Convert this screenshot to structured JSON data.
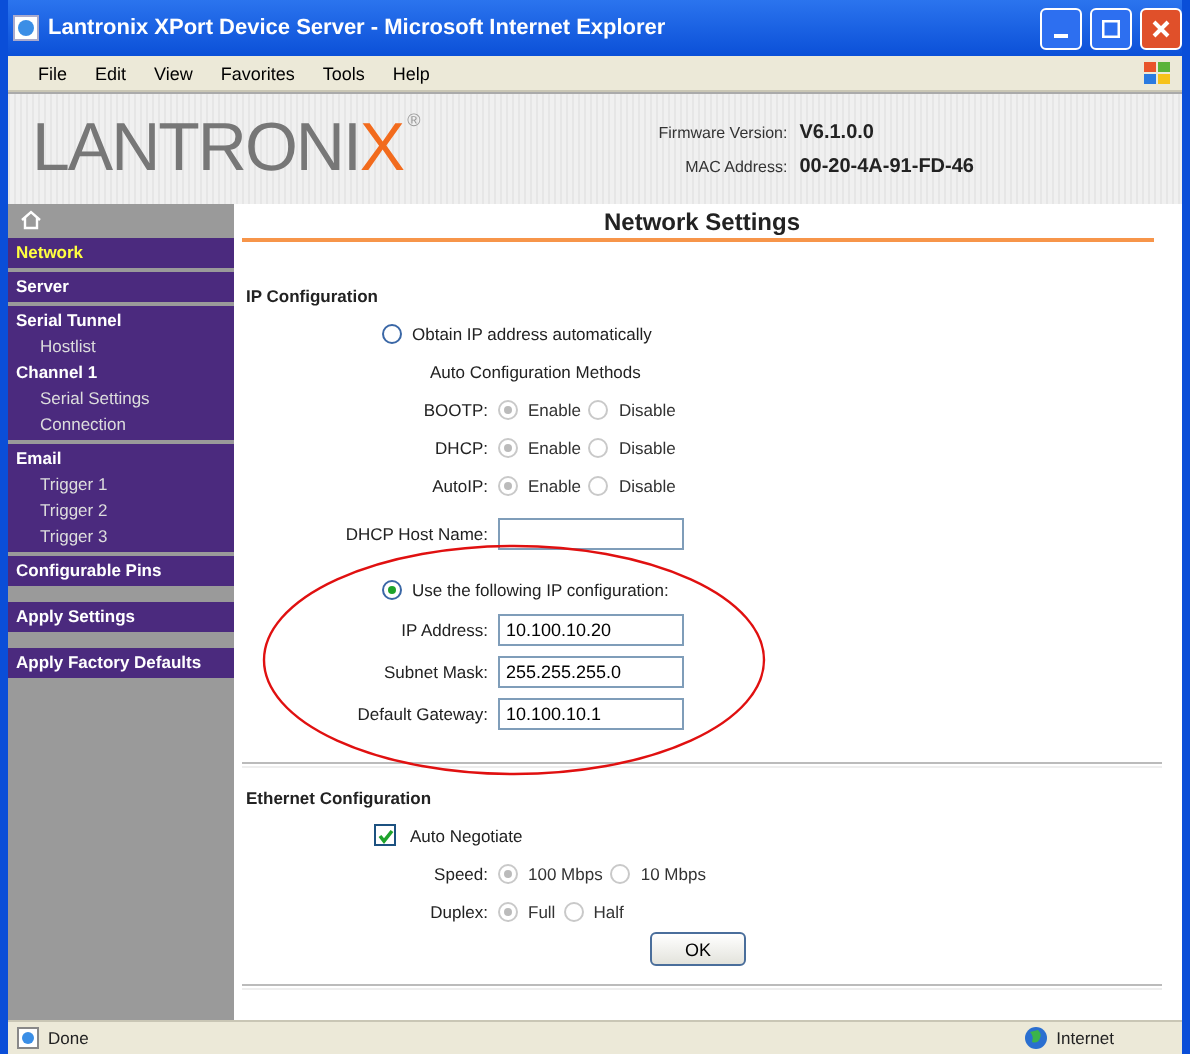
{
  "window": {
    "title": "Lantronix XPort Device Server - Microsoft Internet Explorer"
  },
  "menu": [
    "File",
    "Edit",
    "View",
    "Favorites",
    "Tools",
    "Help"
  ],
  "header": {
    "logo": {
      "text": "LANTRONI",
      "accent": "X",
      "mark": "®"
    },
    "firmware_label": "Firmware Version:",
    "firmware": "V6.1.0.0",
    "mac_label": "MAC Address:",
    "mac": "00-20-4A-91-FD-46"
  },
  "sidebar": {
    "groups": [
      [
        {
          "label": "Network",
          "selected": true
        }
      ],
      [
        {
          "label": "Server",
          "selected": false
        }
      ],
      [
        {
          "label": "Serial Tunnel",
          "selected": false,
          "children": [
            {
              "label": "Hostlist",
              "selected": false
            }
          ]
        },
        {
          "label": "Channel 1",
          "selected": false,
          "children": [
            {
              "label": "Serial Settings",
              "selected": false
            },
            {
              "label": "Connection",
              "selected": false
            }
          ]
        }
      ],
      [
        {
          "label": "Email",
          "selected": false,
          "children": [
            {
              "label": "Trigger 1",
              "selected": false
            },
            {
              "label": "Trigger 2",
              "selected": false
            },
            {
              "label": "Trigger 3",
              "selected": false
            }
          ]
        }
      ],
      [
        {
          "label": "Configurable Pins",
          "selected": false
        }
      ],
      [
        {
          "label": "Apply Settings",
          "selected": false
        }
      ],
      [
        {
          "label": "Apply Factory Defaults",
          "selected": false
        }
      ]
    ]
  },
  "page_title": "Network Settings",
  "ip_config": {
    "heading": "IP Configuration",
    "auto_option": {
      "label": "Obtain IP address automatically",
      "selected": false
    },
    "methods_heading": "Auto Configuration Methods",
    "methods": [
      {
        "label": "BOOTP:",
        "disabled": true,
        "options": [
          {
            "label": "Enable",
            "selected": true
          },
          {
            "label": "Disable",
            "selected": false
          }
        ]
      },
      {
        "label": "DHCP:",
        "disabled": true,
        "options": [
          {
            "label": "Enable",
            "selected": true
          },
          {
            "label": "Disable",
            "selected": false
          }
        ]
      },
      {
        "label": "AutoIP:",
        "disabled": true,
        "options": [
          {
            "label": "Enable",
            "selected": true
          },
          {
            "label": "Disable",
            "selected": false
          }
        ]
      }
    ],
    "host_name": {
      "label": "DHCP Host Name:"
    },
    "manual_option": {
      "label": "Use the following IP configuration:",
      "selected": true
    },
    "fields": [
      {
        "label": "IP Address:",
        "value": "10.100.10.20"
      },
      {
        "label": "Subnet Mask:",
        "value": "255.255.255.0"
      },
      {
        "label": "Default Gateway:",
        "value": "10.100.10.1"
      }
    ]
  },
  "ethernet": {
    "heading": "Ethernet Configuration",
    "auto_negotiate": {
      "label": "Auto Negotiate",
      "checked": true
    },
    "settings": [
      {
        "label": "Speed:",
        "disabled": true,
        "options": [
          {
            "label": "100 Mbps",
            "selected": true
          },
          {
            "label": "10 Mbps",
            "selected": false
          }
        ]
      },
      {
        "label": "Duplex:",
        "disabled": true,
        "options": [
          {
            "label": "Full",
            "selected": true
          },
          {
            "label": "Half",
            "selected": false
          }
        ]
      }
    ],
    "ok_button": "OK"
  },
  "status_bar": {
    "text": "Done",
    "zone": "Internet"
  }
}
